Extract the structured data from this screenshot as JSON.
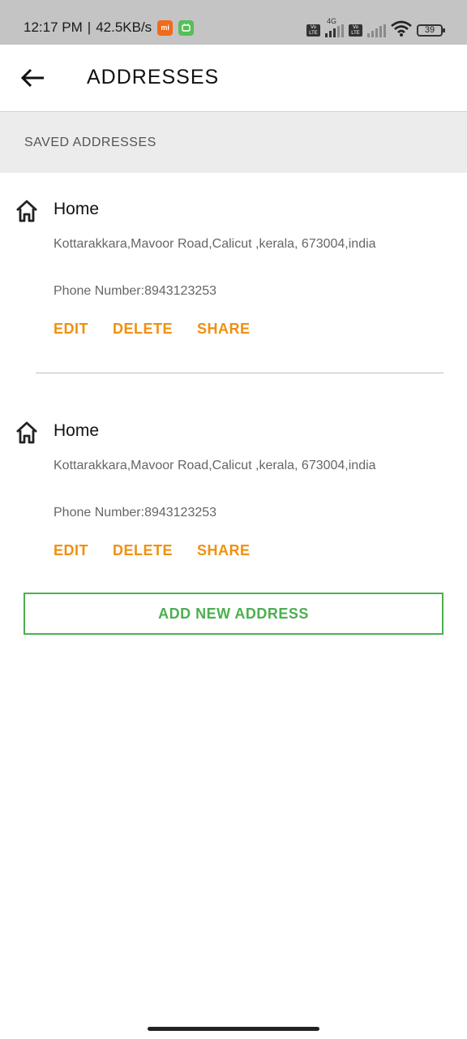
{
  "status_bar": {
    "time": "12:17 PM",
    "separator": "|",
    "speed": "42.5KB/s",
    "mi_badge": "mi",
    "network_label": "4G",
    "volte_label": "Vo LTE",
    "battery": "39"
  },
  "app_bar": {
    "title": "ADDRESSES",
    "back_icon": "arrow-left-icon"
  },
  "section": {
    "header": "SAVED ADDRESSES"
  },
  "addresses": [
    {
      "name": "Home",
      "icon": "home-icon",
      "address": "Kottarakkara,Mavoor Road,Calicut ,kerala, 673004,india",
      "phone": "Phone Number:8943123253",
      "actions": {
        "edit": "EDIT",
        "delete": "DELETE",
        "share": "SHARE"
      }
    },
    {
      "name": "Home",
      "icon": "home-icon",
      "address": "Kottarakkara,Mavoor Road,Calicut ,kerala, 673004,india",
      "phone": "Phone Number:8943123253",
      "actions": {
        "edit": "EDIT",
        "delete": "DELETE",
        "share": "SHARE"
      }
    }
  ],
  "add_button": "ADD NEW ADDRESS",
  "colors": {
    "accent_orange": "#f0900f",
    "accent_green": "#4caf50",
    "status_bar_bg": "#c4c4c4",
    "section_bg": "#ececec"
  }
}
